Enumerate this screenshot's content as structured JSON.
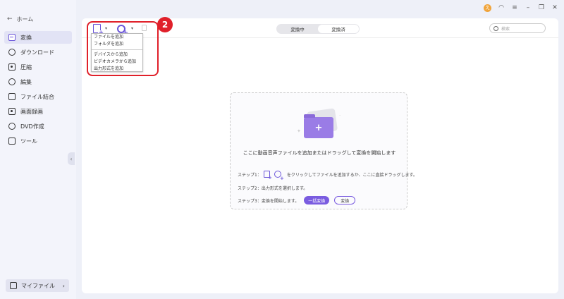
{
  "sidebar": {
    "home_label": "ホーム",
    "items": [
      {
        "label": "変換",
        "icon": "convert-icon"
      },
      {
        "label": "ダウンロード",
        "icon": "download-icon"
      },
      {
        "label": "圧縮",
        "icon": "compress-icon"
      },
      {
        "label": "編集",
        "icon": "scissors-icon"
      },
      {
        "label": "ファイル結合",
        "icon": "merge-icon"
      },
      {
        "label": "画面録画",
        "icon": "screen-record-icon"
      },
      {
        "label": "DVD作成",
        "icon": "dvd-icon"
      },
      {
        "label": "ツール",
        "icon": "tools-icon"
      }
    ],
    "active_index": 0,
    "myfiles_label": "マイファイル",
    "myfiles_chevron": "›",
    "collapse_glyph": "‹"
  },
  "titlebar": {
    "avatar_letter": "え",
    "icons": [
      "avatar-icon",
      "headset-icon",
      "menu-icon",
      "minimize-icon",
      "restore-icon",
      "close-icon"
    ]
  },
  "toolbar": {
    "tabs": [
      "変換中",
      "変換済"
    ],
    "active_tab": 1,
    "search_placeholder": "検索",
    "caret": "▾"
  },
  "dropdown": {
    "items_group1": [
      "ファイルを追加",
      "フォルダを追加"
    ],
    "items_group2": [
      "デバイスから追加",
      "ビデオカメラから追加",
      "出力形式を追加"
    ]
  },
  "annotation": {
    "badge_number": "2",
    "accent_color": "#e0202a"
  },
  "dropzone": {
    "title": "ここに動画音声ファイルを追加またはドラッグして変換を開始します",
    "step1_prefix": "ステップ1：",
    "step1_text": "をクリックしてファイルを追加するか、ここに直接ドラッグします。",
    "step2": "ステップ2：出力形式を選択します。",
    "step3": "ステップ3：変換を開始します。",
    "batch_button": "一括変換",
    "convert_button": "変換",
    "plus": "+"
  },
  "colors": {
    "accent": "#7a5ce0"
  }
}
